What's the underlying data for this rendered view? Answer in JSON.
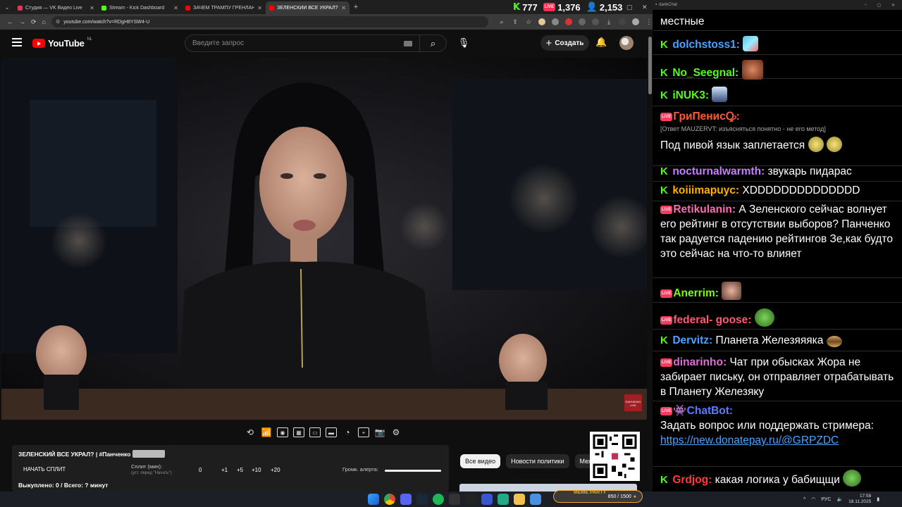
{
  "browser": {
    "tabs": [
      {
        "title": "Студия — VK Видео Live",
        "color": "#ff2e53"
      },
      {
        "title": "Stream - Kick Dashboard",
        "color": "#53fc18"
      },
      {
        "title": "ЗАЧЕМ ТРАМПУ ГРЕНЛАНДИЯ",
        "color": "#ff0000"
      },
      {
        "title": "ЗЕЛЕНСКИЙ ВСЕ УКРАЛ? | #П...",
        "color": "#ff0000"
      }
    ],
    "url": "youtube.com/watch?v=RDgH8YSW4-U"
  },
  "stats": {
    "kick_viewers": "777",
    "vk_viewers": "1,376",
    "total_viewers": "2,153"
  },
  "youtube": {
    "region": "NL",
    "search_placeholder": "Введите запрос",
    "create_label": "Создать",
    "chips": [
      "Все видео",
      "Новости политики",
      "Меж"
    ]
  },
  "video": {
    "watermark": "ПАНЧЕНКО LIVE"
  },
  "panel": {
    "title": "ЗЕЛЕНСКИЙ ВСЕ УКРАЛ? | #Панченко",
    "split_button": "НАЧАТЬ СПЛИТ",
    "split_label": "Сплит (мин):",
    "split_hint": "(уст. перед \"Начать\")",
    "split_value": "0",
    "increments": [
      "+1",
      "+5",
      "+10",
      "+20"
    ],
    "alert_volume_label": "Громк. алерта:",
    "alert_volume": 1.0,
    "bought": "Выкуплено: 0 / Всего: ? минут"
  },
  "chat": {
    "window_title": "dankChat",
    "messages": [
      {
        "platform": "none",
        "user": "",
        "color": "#ffffff",
        "text": "местные",
        "emote": ""
      },
      {
        "platform": "kick",
        "user": "dolchstoss1:",
        "color": "#4aa3ff",
        "text": "",
        "emote": "brush"
      },
      {
        "platform": "kick",
        "user": "No_Seegnal:",
        "color": "#53fc18",
        "text": "",
        "emote": "face"
      },
      {
        "platform": "kick",
        "user": "iNUK3:",
        "color": "#53fc18",
        "text": "",
        "emote": "person"
      },
      {
        "platform": "vk",
        "user": "ГриПенисꝘ:",
        "color": "#ff5a36",
        "reply": "[Ответ MAUZERVT: изъясняться понятно - не его метод]",
        "text": "Под пивой язык заплетается",
        "emote": "bowls"
      },
      {
        "platform": "kick",
        "user": "nocturnalwarmth:",
        "color": "#c77dff",
        "text": "звукарь пидарас",
        "emote": ""
      },
      {
        "platform": "kick",
        "user": "koiiimapuyc:",
        "color": "#ffb000",
        "text": "XDDDDDDDDDDDDDD",
        "emote": ""
      },
      {
        "platform": "vk",
        "user": "Retikulanin:",
        "color": "#ff69b4",
        "text": "А Зеленского сейчас волнует его рейтинг в отсутствии выборов? Панченко так радуется падению рейтингов Зе,как будто это сейчас на что-то влияет",
        "emote": ""
      },
      {
        "platform": "vk",
        "user": "Anerrim:",
        "color": "#7cfc00",
        "text": "",
        "emote": "face2"
      },
      {
        "platform": "vk",
        "user": "federal- goose:",
        "color": "#ff5a6e",
        "text": "",
        "emote": "pepe"
      },
      {
        "platform": "kick",
        "user": "Dervitz:",
        "color": "#4aa3ff",
        "text": "Планета Железяяяка",
        "emote": "burger"
      },
      {
        "platform": "vk",
        "user": "dinarinho:",
        "color": "#da70d6",
        "text": "Чат при обысках Жора не забирает письку, он отправляет отрабатывать в Планету Железяку",
        "emote": ""
      },
      {
        "platform": "vk",
        "user": "ChatBot:",
        "color": "#5c7cff",
        "text": "Задать вопрос или поддержать стримера:",
        "link": "https://new.donatepay.ru/@GRPZDC",
        "emote": ""
      },
      {
        "platform": "kick",
        "user": "Grdjog:",
        "color": "#ff3b3b",
        "text": "какая логика у бабищщи",
        "emote": "pepe"
      }
    ]
  },
  "taskbar": {
    "meme_label": "MEME PARTY",
    "meme_progress": "850 / 1500",
    "lang": "РУС",
    "time": "17:58",
    "date": "18.11.2025"
  }
}
